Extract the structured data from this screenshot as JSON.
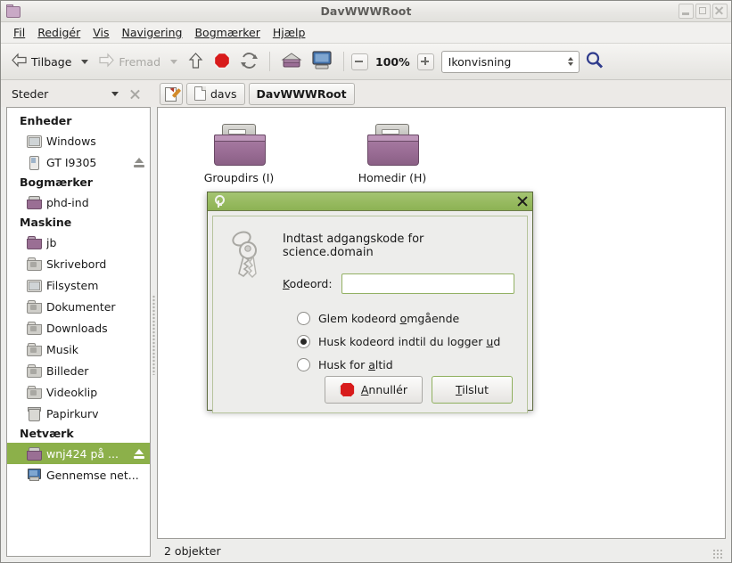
{
  "window": {
    "title": "DavWWWRoot",
    "icon": "folder-icon",
    "controls": {
      "minimize": "minimize-button",
      "maximize": "maximize-button",
      "close": "close-button"
    }
  },
  "menubar": [
    {
      "label": "Fil",
      "accel": "F"
    },
    {
      "label": "Redigér",
      "accel": "R"
    },
    {
      "label": "Vis",
      "accel": "V"
    },
    {
      "label": "Navigering",
      "accel": "N"
    },
    {
      "label": "Bogmærker",
      "accel": "B"
    },
    {
      "label": "Hjælp",
      "accel": "H"
    }
  ],
  "toolbar": {
    "back_label": "Tilbage",
    "forward_label": "Fremad",
    "up_icon": "up-arrow-icon",
    "stop_icon": "stop-icon",
    "reload_icon": "reload-icon",
    "home_icon": "home-icon",
    "computer_icon": "computer-icon",
    "zoom_out_icon": "zoom-out-icon",
    "zoom_level": "100%",
    "zoom_in_icon": "zoom-in-icon",
    "view_mode": "Ikonvisning",
    "search_icon": "search-icon"
  },
  "sidebar": {
    "header": "Steder",
    "groups": [
      {
        "title": "Enheder",
        "items": [
          {
            "label": "Windows",
            "icon": "drive-icon",
            "eject": false,
            "selected": false
          },
          {
            "label": "GT I9305",
            "icon": "phone-icon",
            "eject": true,
            "selected": false
          }
        ]
      },
      {
        "title": "Bogmærker",
        "items": [
          {
            "label": "phd-ind",
            "icon": "network-folder-icon",
            "eject": false,
            "selected": false
          }
        ]
      },
      {
        "title": "Maskine",
        "items": [
          {
            "label": "jb",
            "icon": "home-folder-icon",
            "eject": false,
            "selected": false
          },
          {
            "label": "Skrivebord",
            "icon": "desktop-folder-icon",
            "eject": false,
            "selected": false
          },
          {
            "label": "Filsystem",
            "icon": "drive-icon",
            "eject": false,
            "selected": false
          },
          {
            "label": "Dokumenter",
            "icon": "documents-folder-icon",
            "eject": false,
            "selected": false
          },
          {
            "label": "Downloads",
            "icon": "downloads-folder-icon",
            "eject": false,
            "selected": false
          },
          {
            "label": "Musik",
            "icon": "music-folder-icon",
            "eject": false,
            "selected": false
          },
          {
            "label": "Billeder",
            "icon": "pictures-folder-icon",
            "eject": false,
            "selected": false
          },
          {
            "label": "Videoklip",
            "icon": "videos-folder-icon",
            "eject": false,
            "selected": false
          },
          {
            "label": "Papirkurv",
            "icon": "trash-icon",
            "eject": false,
            "selected": false
          }
        ]
      },
      {
        "title": "Netværk",
        "items": [
          {
            "label": "wnj424 på ...",
            "icon": "network-folder-icon",
            "eject": true,
            "selected": true
          },
          {
            "label": "Gennemse net...",
            "icon": "network-browse-icon",
            "eject": false,
            "selected": false
          }
        ]
      }
    ]
  },
  "breadcrumb": {
    "edit_icon": "edit-location-icon",
    "crumbs": [
      {
        "label": "davs",
        "active": false
      },
      {
        "label": "DavWWWRoot",
        "active": true
      }
    ]
  },
  "content": {
    "items": [
      {
        "label": "Groupdirs (I)",
        "icon": "network-folder-icon"
      },
      {
        "label": "Homedir (H)",
        "icon": "network-folder-icon"
      }
    ]
  },
  "statusbar": {
    "text": "2 objekter"
  },
  "dialog": {
    "title_icon": "key-icon",
    "close_icon": "close-icon",
    "keyring_icon": "keyring-icon",
    "message": "Indtast adgangskode for science.domain",
    "password_label": "Kodeord:",
    "password_value": "",
    "password_placeholder": "",
    "options": [
      {
        "label_a": "Glem kodeord ",
        "accel": "o",
        "label_b": "mgående",
        "checked": false
      },
      {
        "label_a": "Husk kodeord indtil du logger ",
        "accel": "u",
        "label_b": "d",
        "checked": true
      },
      {
        "label_a": "Husk for ",
        "accel": "a",
        "label_b": "ltid",
        "checked": false
      }
    ],
    "cancel_label_a": "A",
    "cancel_label_b": "nnullér",
    "cancel_icon": "stop-icon",
    "connect_label_a": "T",
    "connect_label_b": "ilslut"
  },
  "colors": {
    "selection_green": "#8cb04a",
    "dialog_title_green": "#97ba60",
    "folder_purple": "#9a6d95",
    "stop_red": "#d81b1b"
  }
}
